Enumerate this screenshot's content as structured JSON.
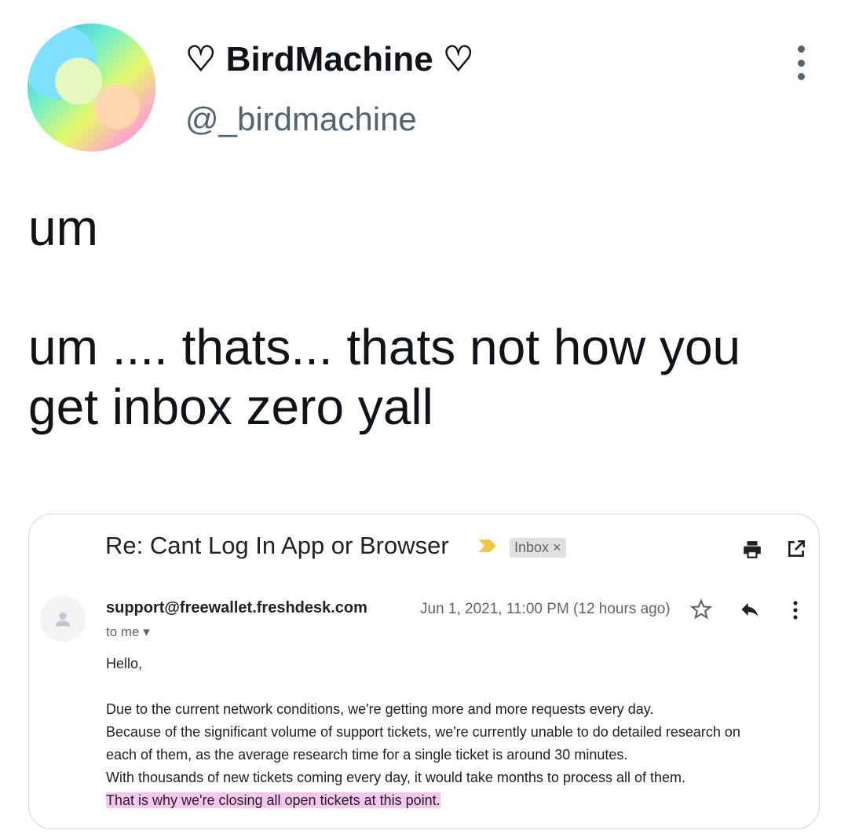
{
  "tweet": {
    "display_name": "♡ BirdMachine ♡",
    "handle": "@_birdmachine",
    "text": "um\n\num .... thats... thats not how you get inbox zero yall"
  },
  "email": {
    "subject": "Re: Cant Log In App or Browser",
    "label": "Inbox ×",
    "sender": "support@freewallet.freshdesk.com",
    "recipient": "to me ▾",
    "date": "Jun 1, 2021, 11:00 PM (12 hours ago)",
    "greeting": "Hello,",
    "body_lines": [
      "Due to the current network conditions, we're getting more and more requests every day.",
      "Because of the significant volume of support tickets, we're currently unable to do detailed research on",
      "each of them, as the average research time for a single ticket is around 30 minutes.",
      "With thousands of new tickets coming every day, it would take months to process all of them."
    ],
    "highlighted_line": "That is why we're closing all open tickets at this point.",
    "highlight_color": "#f7c6ef"
  },
  "icons": {
    "importance": "importance-marker-icon",
    "print": "print-icon",
    "popout": "open-in-new-window-icon",
    "star": "star-icon",
    "reply": "reply-icon",
    "more": "more-vertical-icon"
  }
}
